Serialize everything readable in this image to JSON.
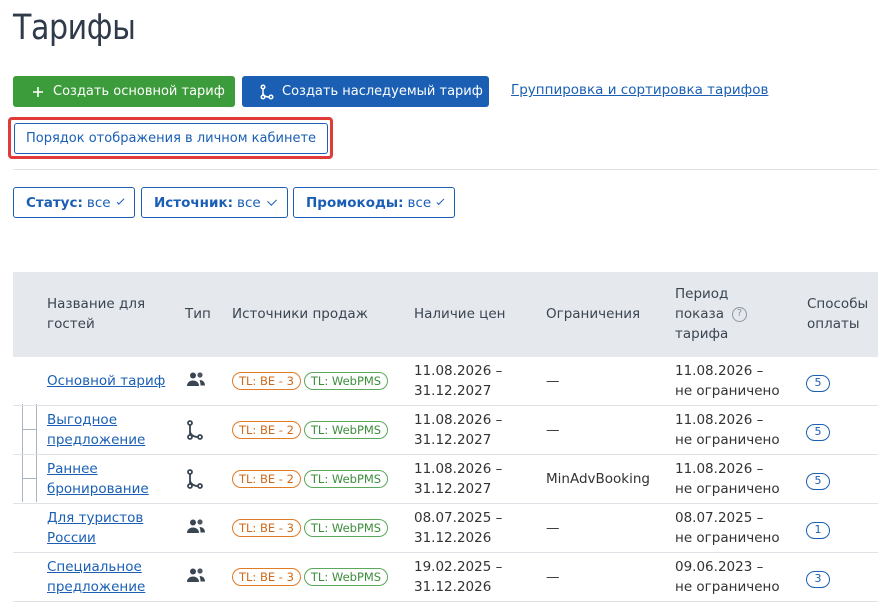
{
  "page": {
    "title": "Тарифы"
  },
  "toolbar": {
    "create_main": "Создать основной тариф",
    "create_inherited": "Создать наследуемый тариф",
    "grouping_link": "Группировка и сортировка тарифов",
    "display_order": "Порядок отображения в личном кабинете"
  },
  "filters": {
    "status_label": "Статус:",
    "status_value": "все",
    "source_label": "Источник:",
    "source_value": "все",
    "promo_label": "Промокоды:",
    "promo_value": "все"
  },
  "table": {
    "headers": {
      "name1": "Название для",
      "name2": "гостей",
      "type": "Тип",
      "sources": "Источники продаж",
      "prices": "Наличие цен",
      "restrictions": "Ограничения",
      "period1": "Период",
      "period2": "показа",
      "period3": "тарифа",
      "payment1": "Способы",
      "payment2": "оплаты"
    },
    "rows": [
      {
        "name1": "Основной тариф",
        "name2": "",
        "type_icon": "people-icon",
        "src1": "TL: BE - 3",
        "src2": "TL: WebPMS",
        "price1": "11.08.2026 –",
        "price2": "31.12.2027",
        "restr": "—",
        "period1": "11.08.2026 –",
        "period2": "не ограничено",
        "payments": "5"
      },
      {
        "name1": "Выгодное",
        "name2": "предложение",
        "type_icon": "branch-icon",
        "src1": "TL: BE - 2",
        "src2": "TL: WebPMS",
        "price1": "11.08.2026 –",
        "price2": "31.12.2027",
        "restr": "—",
        "period1": "11.08.2026 –",
        "period2": "не ограничено",
        "payments": "5"
      },
      {
        "name1": "Раннее",
        "name2": "бронирование",
        "type_icon": "branch-icon",
        "src1": "TL: BE - 2",
        "src2": "TL: WebPMS",
        "price1": "11.08.2026 –",
        "price2": "31.12.2027",
        "restr": "MinAdvBooking",
        "period1": "11.08.2026 –",
        "period2": "не ограничено",
        "payments": "5"
      },
      {
        "name1": "Для туристов",
        "name2": "России",
        "type_icon": "people-icon",
        "src1": "TL: BE - 3",
        "src2": "TL: WebPMS",
        "price1": "08.07.2025 –",
        "price2": "31.12.2026",
        "restr": "—",
        "period1": "08.07.2025 –",
        "period2": "не ограничено",
        "payments": "1"
      },
      {
        "name1": "Специальное",
        "name2": "предложение",
        "type_icon": "people-icon",
        "src1": "TL: BE - 3",
        "src2": "TL: WebPMS",
        "price1": "19.02.2025 –",
        "price2": "31.12.2026",
        "restr": "—",
        "period1": "09.06.2023 –",
        "period2": "не ограничено",
        "payments": "3"
      }
    ]
  },
  "colors": {
    "primary": "#1a5fb4",
    "success": "#3c9b3a",
    "highlight": "#e03a3a",
    "source_be": "#e07b26",
    "source_pms": "#5aa85a"
  }
}
